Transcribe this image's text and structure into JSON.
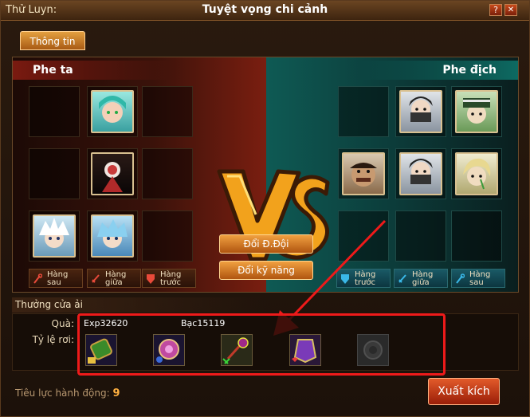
{
  "window": {
    "title_left": "Thử Luyn:",
    "title": "Tuyệt vọng chi cảnh",
    "help_label": "?",
    "close_label": "✕"
  },
  "tabs": [
    {
      "label": "Thông tin"
    }
  ],
  "battle": {
    "left_side_label": "Phe ta",
    "right_side_label": "Phe địch",
    "vs_text": "VS",
    "buttons": {
      "change_team": "Đổi Đ.Đội",
      "change_skill": "Đổi kỹ năng"
    },
    "ally_rows": [
      {
        "label_line1": "Hàng",
        "label_line2": "sau",
        "icon": "staff-icon"
      },
      {
        "label_line1": "Hàng",
        "label_line2": "giữa",
        "icon": "sword-icon"
      },
      {
        "label_line1": "Hàng",
        "label_line2": "trước",
        "icon": "shield-icon"
      }
    ],
    "enemy_rows": [
      {
        "label_line1": "Hàng",
        "label_line2": "trước",
        "icon": "shield-icon"
      },
      {
        "label_line1": "Hàng",
        "label_line2": "giữa",
        "icon": "sword-icon"
      },
      {
        "label_line1": "Hàng",
        "label_line2": "sau",
        "icon": "staff-icon"
      }
    ]
  },
  "rewards": {
    "section_title": "Thưởng cửa ải",
    "gift_label": "Quà:",
    "exp_label": "Exp32620",
    "silver_label": "Bạc15119",
    "drop_label": "Tỷ lệ rơi:",
    "items": [
      {
        "icon": "bracer-item-icon",
        "tier_badge": "bronze"
      },
      {
        "icon": "amulet-item-icon",
        "tier_badge": "blue"
      },
      {
        "icon": "spiked-mace-item-icon",
        "tier_badge": "green"
      },
      {
        "icon": "armor-item-icon",
        "tier_badge": "red"
      },
      {
        "icon": "locked-item-icon",
        "tier_badge": "none"
      }
    ]
  },
  "footer": {
    "action_power_label": "Tiêu lực hành động:",
    "action_power_value": "9",
    "attack_button": "Xuất kích"
  },
  "colors": {
    "highlight_box": "#ee1a1a",
    "accent_orange": "#e8902a",
    "enemy_teal": "#0d6a62",
    "ally_red": "#7a1a10"
  }
}
